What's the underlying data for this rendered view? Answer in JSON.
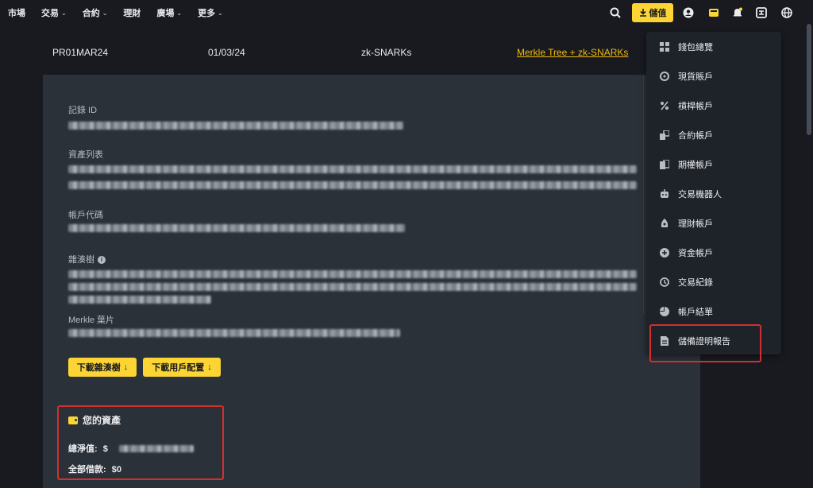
{
  "nav": {
    "items": [
      {
        "label": "市場",
        "has_caret": false
      },
      {
        "label": "交易",
        "has_caret": true
      },
      {
        "label": "合約",
        "has_caret": true
      },
      {
        "label": "理財",
        "has_caret": false
      },
      {
        "label": "廣場",
        "has_caret": true
      },
      {
        "label": "更多",
        "has_caret": true
      }
    ],
    "deposit_label": "儲值",
    "caret": "⌄"
  },
  "header": {
    "col1": "PR01MAR24",
    "col2": "01/03/24",
    "col3": "zk-SNARKs",
    "link": "Merkle Tree + zk-SNARKs"
  },
  "panel": {
    "record_id_label": "記錄 ID",
    "asset_list_label": "資產列表",
    "account_code_label": "帳戶代碼",
    "hash_tree_label": "雜湊樹",
    "info_glyph": "i",
    "merkle_leaf_label": "Merkle 葉片",
    "download_tree_btn": "下載雜湊樹",
    "download_user_btn": "下載用戶配置",
    "download_arrow": "↓"
  },
  "assets": {
    "title": "您的資產",
    "net_value_label": "總淨值:",
    "net_value_prefix": "$",
    "total_borrow_label": "全部借款:",
    "total_borrow_value": "$0"
  },
  "dropdown": {
    "items": [
      {
        "label": "錢包總覽",
        "icon": "grid-icon"
      },
      {
        "label": "現貨賬戶",
        "icon": "spot-icon"
      },
      {
        "label": "槓桿帳戶",
        "icon": "percent-icon"
      },
      {
        "label": "合約帳戶",
        "icon": "futures-icon"
      },
      {
        "label": "期權帳戶",
        "icon": "options-icon"
      },
      {
        "label": "交易機器人",
        "icon": "robot-icon"
      },
      {
        "label": "理財帳戶",
        "icon": "earn-icon"
      },
      {
        "label": "資金帳戶",
        "icon": "funding-icon"
      },
      {
        "label": "交易紀錄",
        "icon": "history-icon"
      },
      {
        "label": "帳戶結單",
        "icon": "pie-icon"
      },
      {
        "label": "儲備證明報告",
        "icon": "document-icon"
      }
    ]
  },
  "colors": {
    "accent": "#fcd535",
    "bg": "#181a20",
    "panel": "#2b3139",
    "highlight": "#d32f2f"
  }
}
